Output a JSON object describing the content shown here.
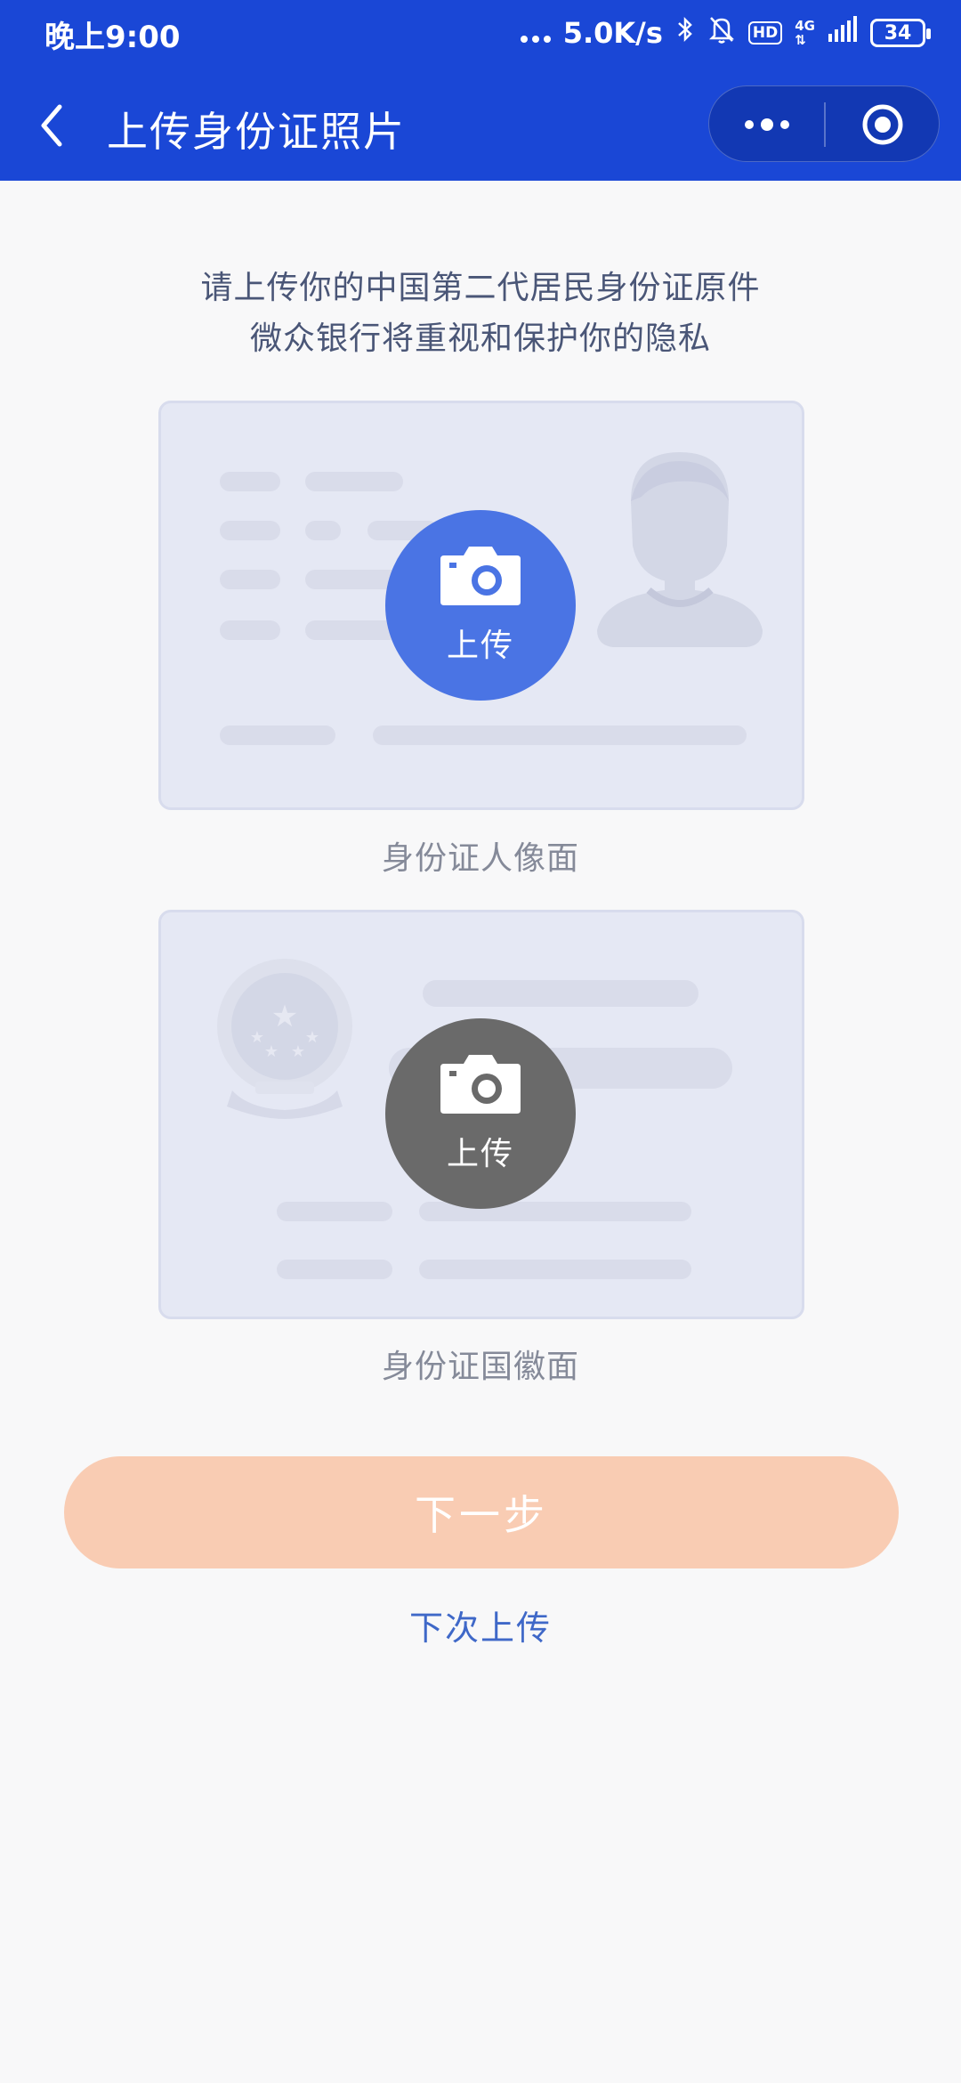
{
  "status_bar": {
    "time": "晚上9:00",
    "speed": "5.0K/s",
    "hd": "HD",
    "network": "4G",
    "battery": "34",
    "icons": [
      "more-dots-icon",
      "bluetooth-icon",
      "mute-bell-icon",
      "signal-icon",
      "battery-icon"
    ]
  },
  "nav": {
    "title": "上传身份证照片",
    "back_icon": "chevron-left-icon",
    "more_icon": "more-dots-icon",
    "close_icon": "target-circle-icon"
  },
  "intro": {
    "line1": "请上传你的中国第二代居民身份证原件",
    "line2": "微众银行将重视和保护你的隐私"
  },
  "cards": [
    {
      "upload_label": "上传",
      "caption": "身份证人像面",
      "button_color": "#4a74e4"
    },
    {
      "upload_label": "上传",
      "caption": "身份证国徽面",
      "button_color": "#6a6a6a"
    }
  ],
  "actions": {
    "next_label": "下一步",
    "next_color": "#f9ccb3",
    "later_label": "下次上传",
    "later_color": "#3f68c8"
  },
  "colors": {
    "header": "#1a47d6",
    "background": "#f8f8f9",
    "card": "#e5e8f4"
  }
}
